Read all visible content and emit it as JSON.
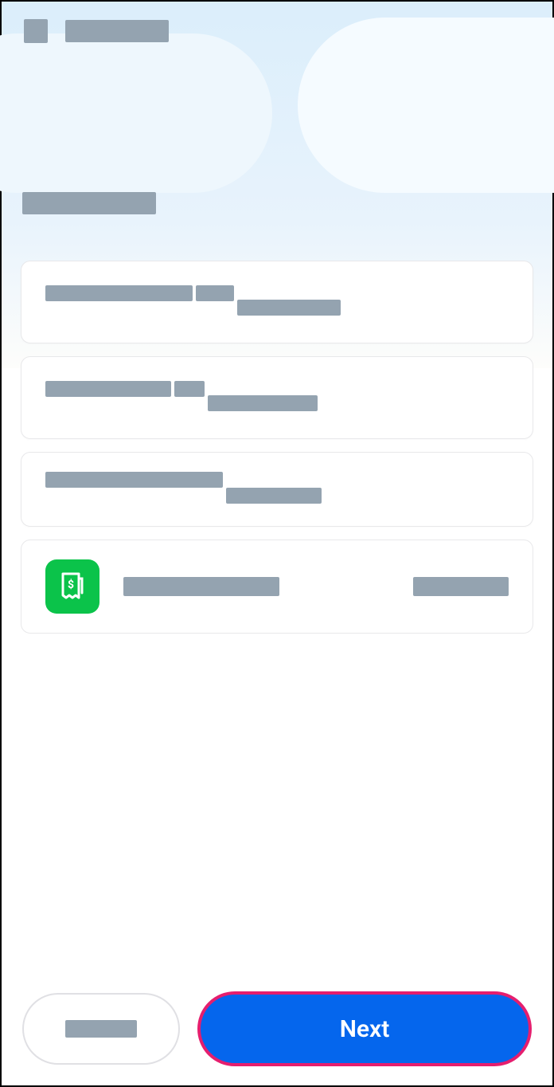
{
  "header": {
    "icon_name": "menu-icon",
    "title": ""
  },
  "section": {
    "title": ""
  },
  "cards": [
    {
      "lines": [
        "",
        "",
        ""
      ]
    },
    {
      "lines": [
        "",
        "",
        ""
      ]
    },
    {
      "lines": [
        "",
        ""
      ]
    }
  ],
  "payment": {
    "icon_name": "receipt-dollar-icon",
    "label": "",
    "value": ""
  },
  "footer": {
    "secondary_label": "",
    "primary_label": "Next"
  }
}
